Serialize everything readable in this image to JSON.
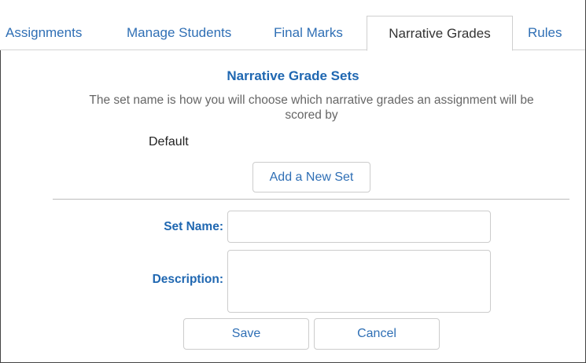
{
  "tabs": [
    {
      "label": "Assignments",
      "active": false
    },
    {
      "label": "Manage Students",
      "active": false
    },
    {
      "label": "Final Marks",
      "active": false
    },
    {
      "label": "Narrative Grades",
      "active": true
    },
    {
      "label": "Rules",
      "active": false
    }
  ],
  "section": {
    "title": "Narrative Grade Sets",
    "description": "The set name is how you will choose which narrative grades an assignment will be scored by"
  },
  "sets": [
    {
      "name": "Default"
    }
  ],
  "actions": {
    "add_set_label": "Add a New Set",
    "save_label": "Save",
    "cancel_label": "Cancel"
  },
  "form": {
    "set_name_label": "Set Name:",
    "set_name_value": "",
    "description_label": "Description:",
    "description_value": ""
  },
  "colors": {
    "accent": "#1f67b1",
    "link": "#2f6fb5",
    "muted_text": "#666666",
    "border": "#cccccc"
  }
}
